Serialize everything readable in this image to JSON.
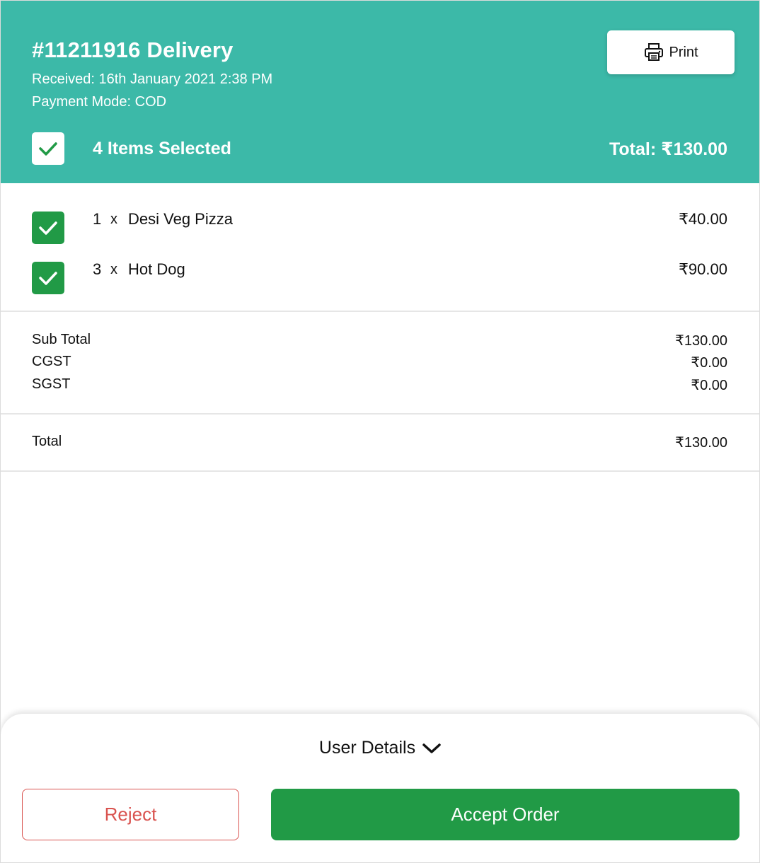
{
  "header": {
    "order_title": "#11211916 Delivery",
    "received": "Received: 16th January 2021 2:38 PM",
    "payment_mode": "Payment Mode: COD",
    "print_label": "Print",
    "print_icon": "printer-icon",
    "items_selected": "4 Items Selected",
    "total": "Total: ₹130.00",
    "background_color": "#3cb9a8"
  },
  "items": [
    {
      "qty": "1",
      "separator": "x",
      "name": "Desi Veg Pizza",
      "price": "₹40.00",
      "checked": true
    },
    {
      "qty": "3",
      "separator": "x",
      "name": "Hot Dog",
      "price": "₹90.00",
      "checked": true
    }
  ],
  "summary": {
    "rows": [
      {
        "label": "Sub Total",
        "value": "₹130.00"
      },
      {
        "label": "CGST",
        "value": "₹0.00"
      },
      {
        "label": "SGST",
        "value": "₹0.00"
      }
    ],
    "total_label": "Total",
    "total_value": "₹130.00"
  },
  "footer": {
    "user_details_label": "User Details",
    "user_details_icon": "chevron-down-icon",
    "reject_label": "Reject",
    "accept_label": "Accept Order",
    "accent_green": "#219a46",
    "reject_red": "#d9534f"
  }
}
